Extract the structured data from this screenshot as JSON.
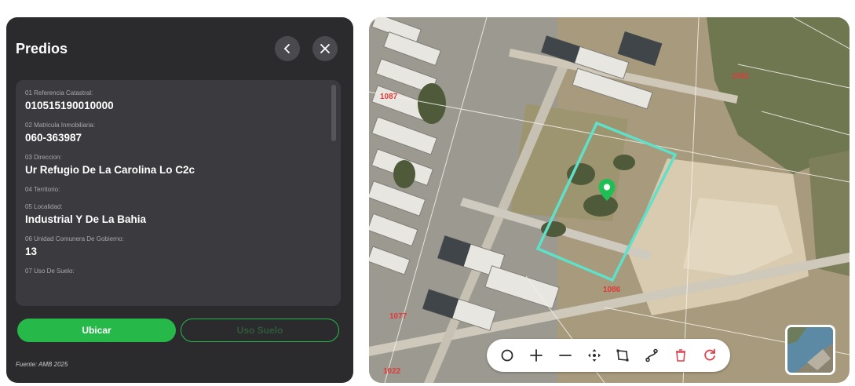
{
  "panel": {
    "title": "Predios",
    "fields": [
      {
        "label": "01 Referencia Catastral:",
        "value": "010515190010000"
      },
      {
        "label": "02 Matricula Inmobiliaria:",
        "value": "060-363987"
      },
      {
        "label": "03 Direccion:",
        "value": "Ur Refugio De La Carolina Lo C2c"
      },
      {
        "label": "04 Territorio:",
        "value": ""
      },
      {
        "label": "05 Localidad:",
        "value": "Industrial Y De La Bahia"
      },
      {
        "label": "06 Unidad Comunera De Gobierno:",
        "value": "13"
      },
      {
        "label": "07 Uso De Suelo:",
        "value": ""
      }
    ],
    "buttons": {
      "ubicar": "Ubicar",
      "uso_suelo": "Uso Suelo"
    },
    "footer": "Fuente: AMB 2025"
  },
  "map": {
    "parcel_labels": [
      "1091",
      "1087",
      "1086",
      "1077",
      "1022"
    ],
    "toolbar_icons": [
      "circle-icon",
      "zoom-in-icon",
      "zoom-out-icon",
      "move-icon",
      "polygon-icon",
      "route-icon",
      "trash-icon",
      "refresh-icon"
    ]
  },
  "colors": {
    "accent_green": "#27b84a",
    "parcel_outline": "#5fe0c8",
    "marker": "#1fbf55",
    "toolbar_red": "#e0404a"
  }
}
